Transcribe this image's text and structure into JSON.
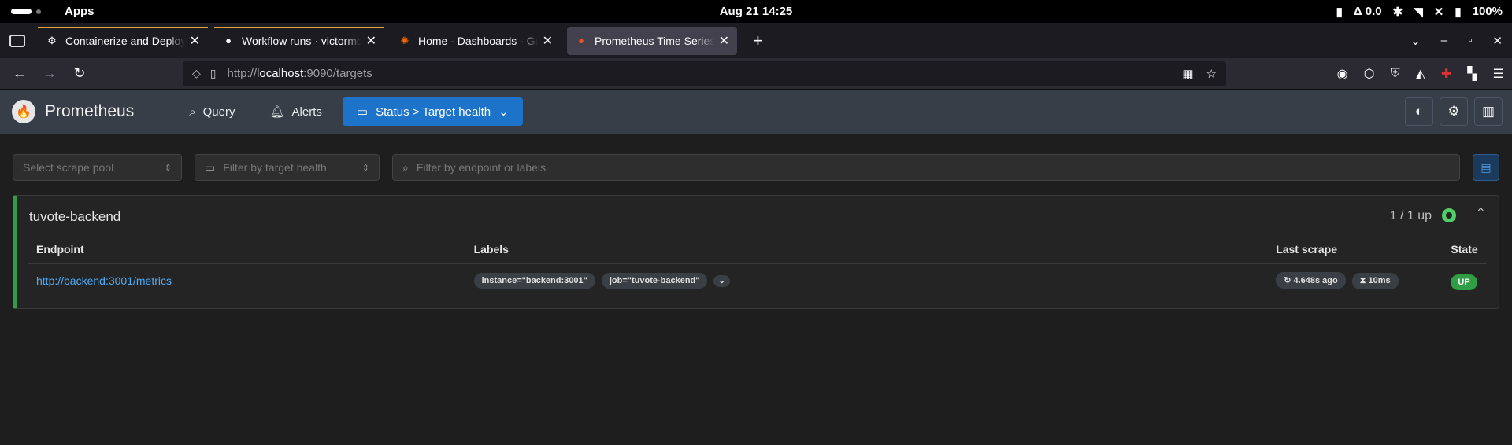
{
  "system_bar": {
    "apps_label": "Apps",
    "clock": "Aug 21  14:25",
    "cpu": "Δ 0.0",
    "battery": "100%"
  },
  "browser": {
    "tabs": [
      {
        "title": "Containerize and Deploy W",
        "icon": "openai-icon",
        "active": false
      },
      {
        "title": "Workflow runs · victormde",
        "icon": "github-icon",
        "active": false
      },
      {
        "title": "Home - Dashboards - Grafa",
        "icon": "grafana-icon",
        "active": false
      },
      {
        "title": "Prometheus Time Series Co",
        "icon": "prometheus-icon",
        "active": true
      }
    ],
    "url_prefix": "http://",
    "url_host": "localhost",
    "url_rest": ":9090/targets"
  },
  "prometheus": {
    "brand": "Prometheus",
    "nav": {
      "query": "Query",
      "alerts": "Alerts",
      "status": "Status > Target health"
    },
    "filters": {
      "scrape_pool_placeholder": "Select scrape pool",
      "target_health_placeholder": "Filter by target health",
      "search_placeholder": "Filter by endpoint or labels"
    },
    "pool": {
      "name": "tuvote-backend",
      "up_count": "1 / 1 up",
      "columns": {
        "endpoint": "Endpoint",
        "labels": "Labels",
        "last_scrape": "Last scrape",
        "state": "State"
      },
      "targets": [
        {
          "endpoint": "http://backend:3001/metrics",
          "labels": [
            "instance=\"backend:3001\"",
            "job=\"tuvote-backend\""
          ],
          "last_scrape": "4.648s ago",
          "duration": "10ms",
          "state": "UP"
        }
      ]
    }
  }
}
